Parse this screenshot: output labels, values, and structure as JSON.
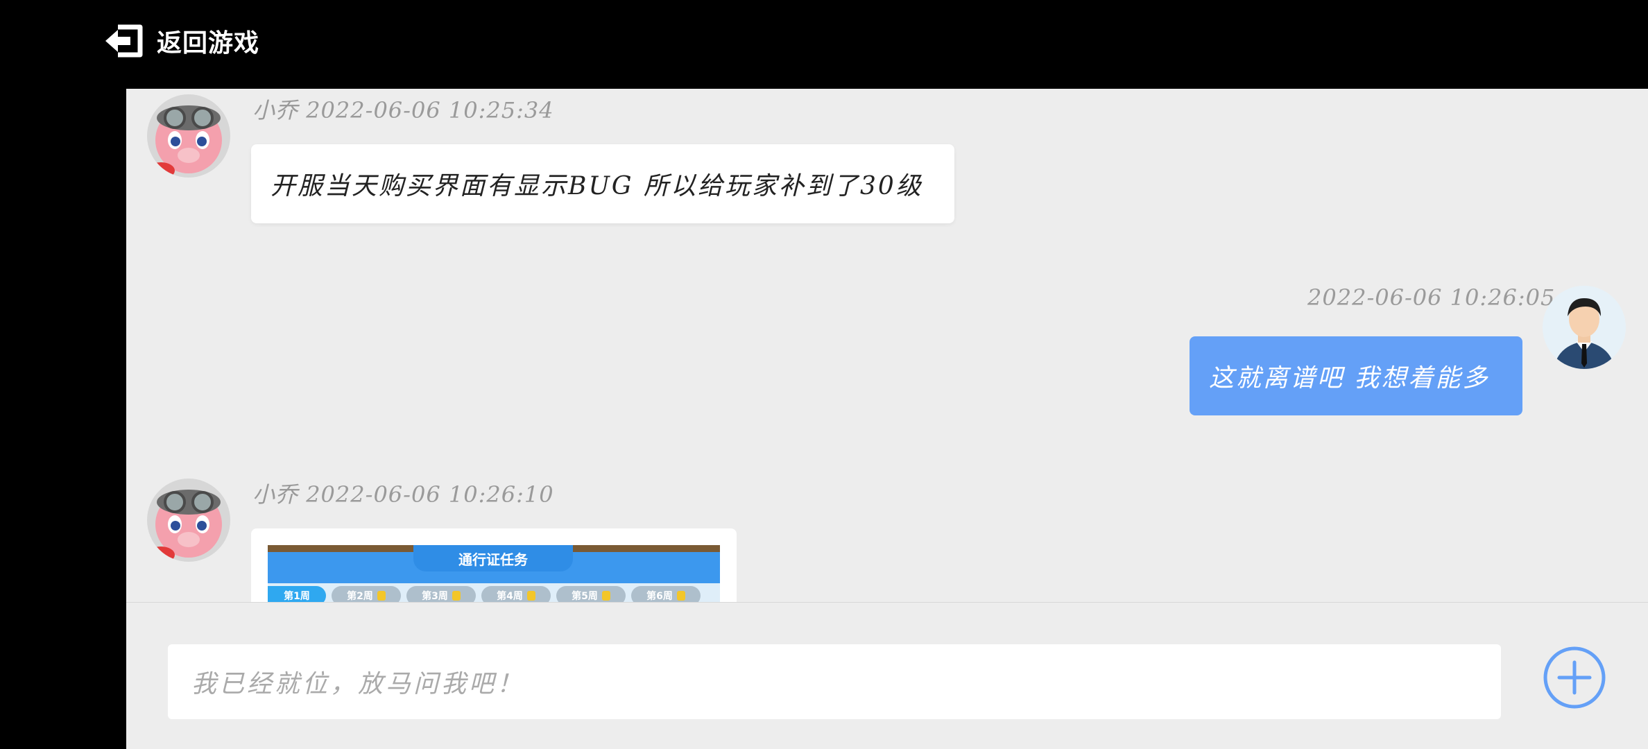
{
  "header": {
    "back_label": "返回游戏"
  },
  "messages": [
    {
      "sender": "小乔",
      "time": "2022-06-06 10:25:34",
      "text": "开服当天购买界面有显示BUG 所以给玩家补到了30级"
    },
    {
      "time": "2022-06-06 10:26:05",
      "text": "这就离谱吧 我想着能多"
    },
    {
      "sender": "小乔",
      "time": "2022-06-06 10:26:10",
      "image": {
        "title": "通行证任务",
        "tabs": [
          "第1周",
          "第2周",
          "第3周",
          "第4周",
          "第5周",
          "第6周"
        ]
      }
    }
  ],
  "composer": {
    "placeholder": "我已经就位，放马问我吧！"
  },
  "colors": {
    "accent": "#64a0f7",
    "panel": "#ededed",
    "bar": "#000000"
  }
}
